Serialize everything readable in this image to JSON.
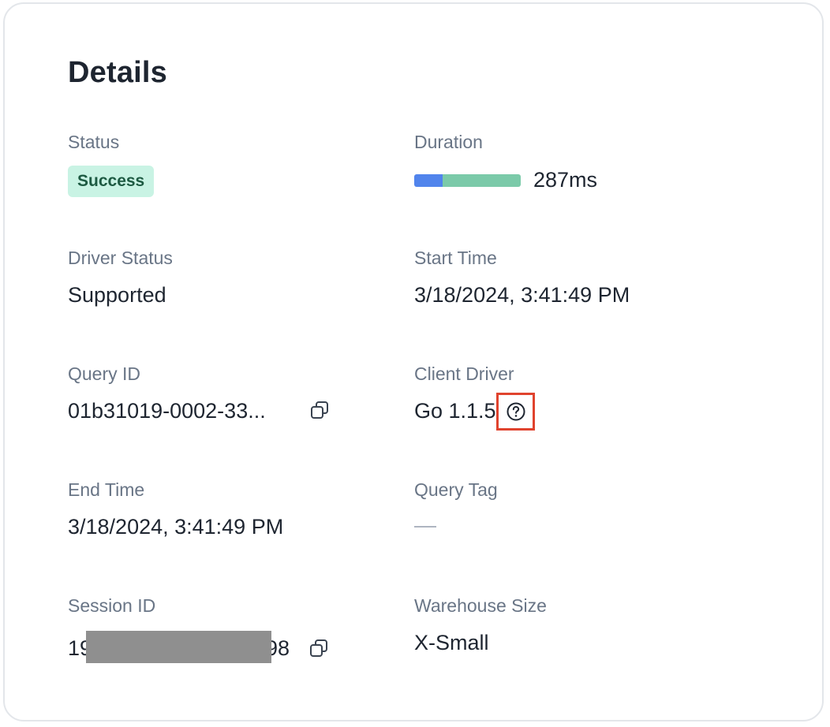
{
  "card": {
    "title": "Details"
  },
  "status": {
    "label": "Status",
    "value": "Success"
  },
  "duration": {
    "label": "Duration",
    "value": "287ms",
    "bar_segments": [
      {
        "name": "compilation",
        "fraction": 0.27,
        "color": "#5184ec"
      },
      {
        "name": "execution",
        "fraction": 0.73,
        "color": "#7bcaa9"
      }
    ]
  },
  "driver_status": {
    "label": "Driver Status",
    "value": "Supported"
  },
  "start_time": {
    "label": "Start Time",
    "value": "3/18/2024, 3:41:49 PM"
  },
  "query_id": {
    "label": "Query ID",
    "value": "01b31019-0002-33...",
    "copy_icon": "copy-icon"
  },
  "client_driver": {
    "label": "Client Driver",
    "value": "Go 1.1.5",
    "help_icon": "help-circle-icon"
  },
  "end_time": {
    "label": "End Time",
    "value": "3/18/2024, 3:41:49 PM"
  },
  "query_tag": {
    "label": "Query Tag",
    "value": "—"
  },
  "session_id": {
    "label": "Session ID",
    "prefix": "19",
    "suffix": "98",
    "copy_icon": "copy-icon"
  },
  "warehouse_size": {
    "label": "Warehouse Size",
    "value": "X-Small"
  },
  "colors": {
    "badge_bg": "#c9f3e4",
    "badge_text": "#1d5a42",
    "label_text": "#697586",
    "value_text": "#1e2530",
    "highlight_border": "#e0432e"
  }
}
